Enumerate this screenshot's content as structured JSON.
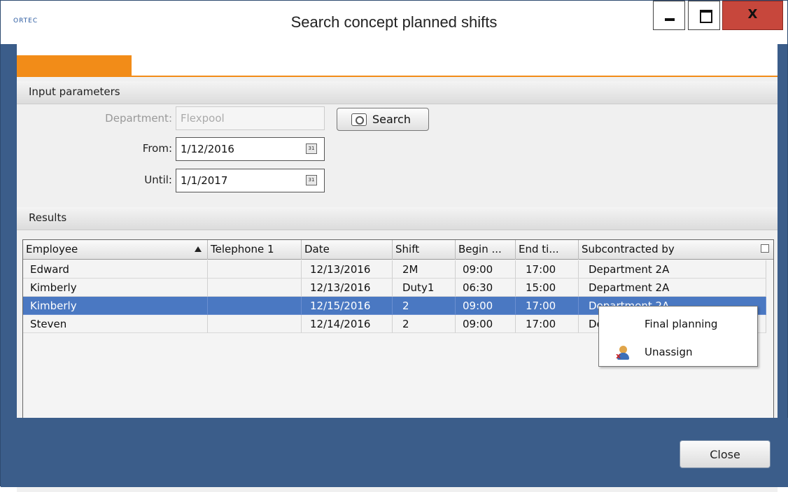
{
  "window": {
    "title": "Search concept planned shifts",
    "logo_text": "ORTEC",
    "close_glyph": "X"
  },
  "sections": {
    "input": "Input parameters",
    "results": "Results"
  },
  "form": {
    "department": {
      "label": "Department:",
      "value": "Flexpool"
    },
    "from": {
      "label": "From:",
      "value": "1/12/2016",
      "cal_text": "31"
    },
    "until": {
      "label": "Until:",
      "value": "1/1/2017",
      "cal_text": "31"
    },
    "search_label": "Search"
  },
  "grid": {
    "columns": [
      "Employee",
      "Telephone 1",
      "Date",
      "Shift",
      "Begin ...",
      "End ti...",
      "Subcontracted by"
    ],
    "rows": [
      [
        "Edward",
        "",
        "12/13/2016",
        "2M",
        "09:00",
        "17:00",
        "Department 2A"
      ],
      [
        "Kimberly",
        "",
        "12/13/2016",
        "Duty1",
        "06:30",
        "15:00",
        "Department 2A"
      ],
      [
        "Kimberly",
        "",
        "12/15/2016",
        "2",
        "09:00",
        "17:00",
        "Department 2A"
      ],
      [
        "Steven",
        "",
        "12/14/2016",
        "2",
        "09:00",
        "17:00",
        "Department 2A"
      ]
    ],
    "selected_row": 2
  },
  "context_menu": {
    "items": [
      "Final planning",
      "Unassign"
    ]
  },
  "footer": {
    "close_label": "Close"
  },
  "colors": {
    "accent": "#f28c18",
    "selection": "#4a78c2",
    "frame": "#3b5d8a"
  }
}
